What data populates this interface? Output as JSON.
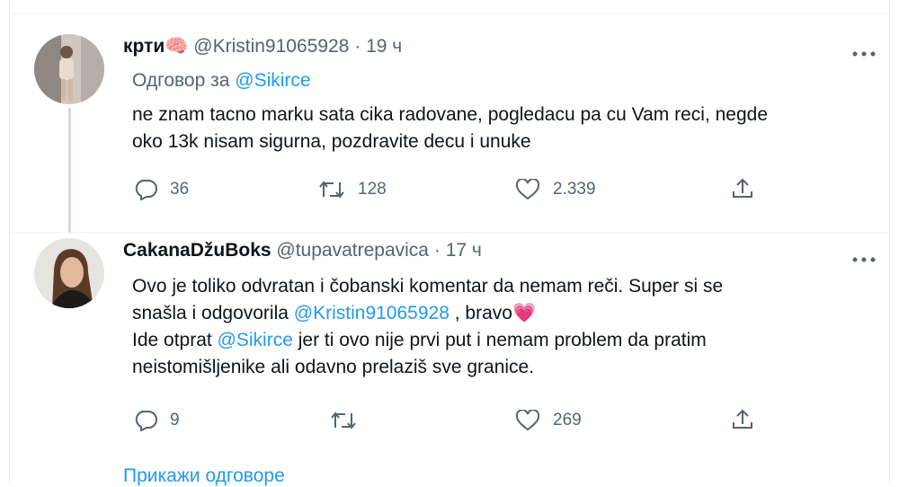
{
  "tweets": [
    {
      "name": "крти",
      "name_emoji": "🧠",
      "handle": "@Kristin91065928",
      "separator": "·",
      "time": "19 ч",
      "reply_prefix": "Одговор за",
      "reply_to": "@Sikirce",
      "text_lines": [
        "ne znam tacno marku sata cika radovane, pogledacu pa cu Vam reci, negde",
        "oko 13k nisam sigurna, pozdravite decu i unuke"
      ],
      "replies": "36",
      "retweets": "128",
      "likes": "2.339"
    },
    {
      "name": "CakanaDžuBoks",
      "handle": "@tupavatrepavica",
      "separator": "·",
      "time": "17 ч",
      "line1": "Ovo je toliko odvratan i čobanski komentar da nemam reči. Super si se",
      "line2_pre": "snašla i odgovorila ",
      "line2_mention": "@Kristin91065928",
      "line2_post": " , bravo",
      "line2_emoji": "💗",
      "line3_pre": "Ide otprat ",
      "line3_mention": "@Sikirce",
      "line3_post": " jer ti ovo nije prvi put i nemam problem da pratim",
      "line4": "neistomišljenike ali odavno prelaziš sve granice.",
      "replies": "9",
      "retweets": "",
      "likes": "269"
    }
  ],
  "show_replies": "Прикажи одговоре",
  "icons": {
    "more": "more-icon",
    "reply": "reply-icon",
    "retweet": "retweet-icon",
    "like": "like-icon",
    "share": "share-icon"
  },
  "colors": {
    "link": "#1d9bf0",
    "secondary_text": "#536471",
    "primary_text": "#0f1419",
    "thread_line": "#cfd9de"
  }
}
